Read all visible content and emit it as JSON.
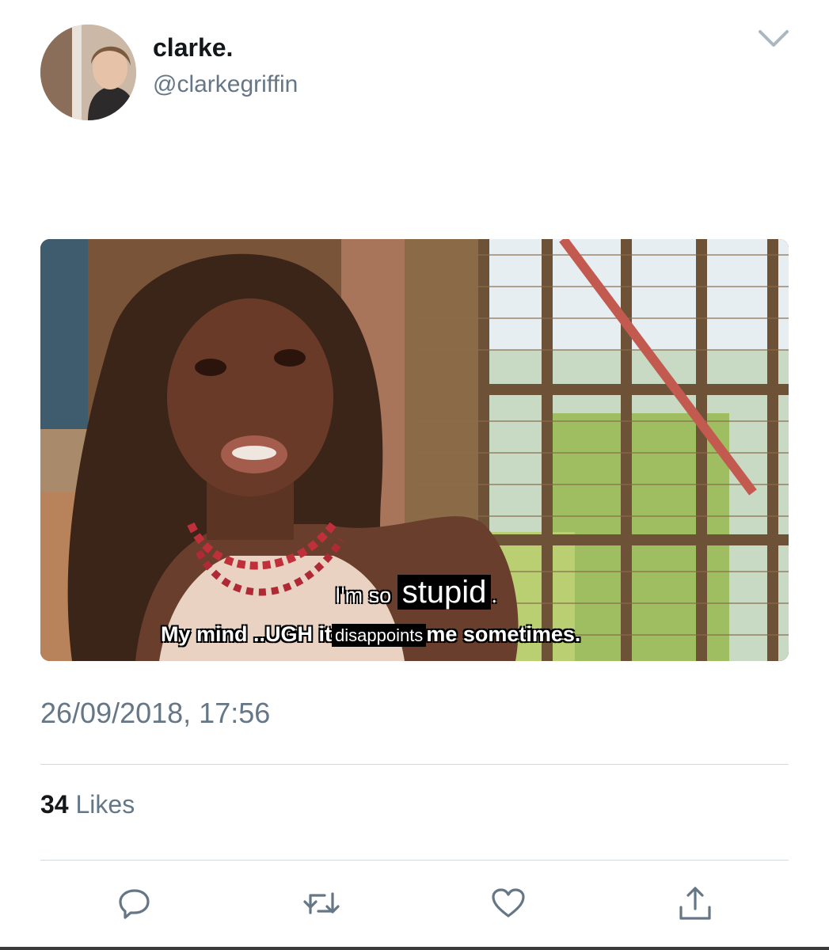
{
  "tweet": {
    "display_name": "clarke.",
    "handle": "@clarkegriffin",
    "timestamp": "26/09/2018, 17:56",
    "likes_count": "34",
    "likes_label": "Likes"
  },
  "media": {
    "subtitle_line1_a": "I'm so",
    "subtitle_line1_b": "stupid",
    "subtitle_line1_c": ".",
    "subtitle_line2_a": "My mind ..UGH it",
    "subtitle_line2_b": "disappoints",
    "subtitle_line2_c": "me sometimes."
  },
  "icons": {
    "menu": "chevron-down-icon",
    "reply": "reply-icon",
    "retweet": "retweet-icon",
    "like": "heart-icon",
    "share": "share-icon"
  },
  "colors": {
    "secondary_text": "#657786",
    "primary_text": "#14171a",
    "divider": "#d4dadf",
    "icon": "#657786"
  }
}
